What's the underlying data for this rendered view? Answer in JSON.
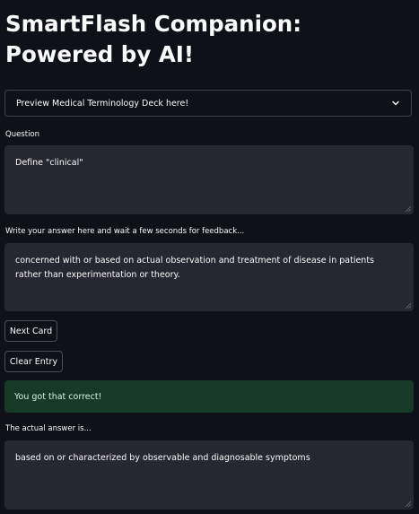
{
  "app": {
    "title": "SmartFlash Companion: Powered by AI!"
  },
  "expander": {
    "label": "Preview Medical Terminology Deck here!"
  },
  "question": {
    "label": "Question",
    "value": "Define \"clinical\""
  },
  "answer": {
    "label": "Write your answer here and wait a few seconds for feedback...",
    "value": "concerned with or based on actual observation and treatment of disease in patients rather than experimentation or theory."
  },
  "buttons": {
    "next_card": "Next Card",
    "clear_entry": "Clear Entry"
  },
  "feedback": {
    "message": "You got that correct!",
    "color": "#173928"
  },
  "actual_answer": {
    "label": "The actual answer is...",
    "value": "based on or characterized by observable and diagnosable symptoms"
  },
  "icons": {
    "expander": "chevron-down-icon",
    "resize": "resize-grip-icon"
  }
}
